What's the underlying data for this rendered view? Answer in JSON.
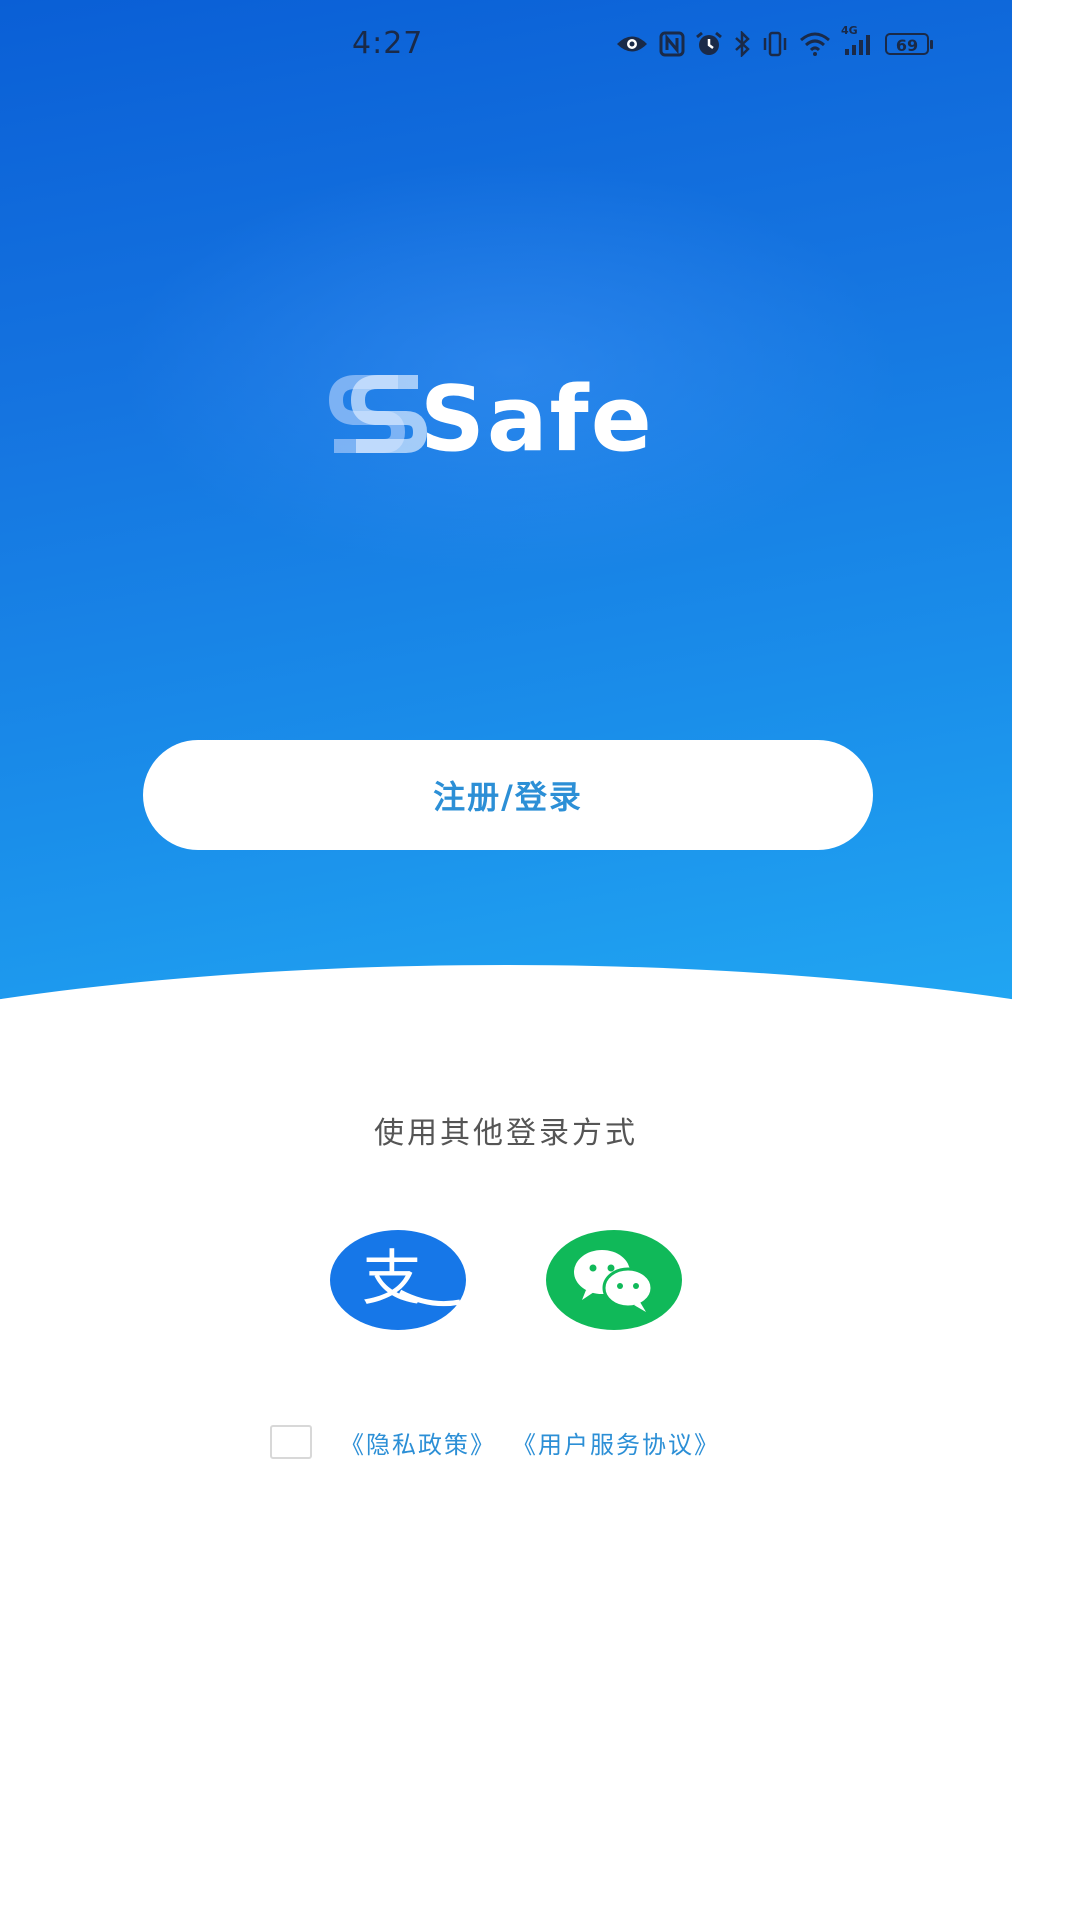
{
  "status_bar": {
    "time": "4:27",
    "network": "4G",
    "battery": "69"
  },
  "logo": {
    "text": "Safe"
  },
  "login_button": {
    "label": "注册/登录"
  },
  "other_login": {
    "label": "使用其他登录方式"
  },
  "social": {
    "alipay_glyph": "支"
  },
  "agreement": {
    "privacy_policy": "《隐私政策》",
    "user_agreement": "《用户服务协议》"
  },
  "colors": {
    "hero_top": "#0a5fd6",
    "hero_bottom": "#21a6f2",
    "link_blue": "#2c8fd6",
    "alipay_blue": "#1677e8",
    "wechat_green": "#10b959"
  }
}
